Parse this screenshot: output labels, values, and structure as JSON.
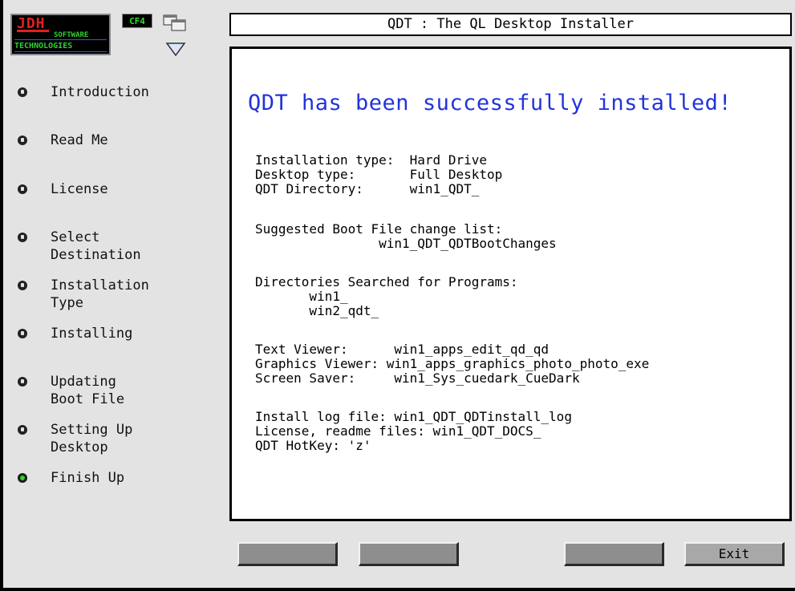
{
  "logo": {
    "line1": "JDH",
    "line2": "SOFTWARE",
    "line3": "TECHNOLOGIES"
  },
  "badge": "CF4",
  "icons": {
    "windows": "windows-icon",
    "down": "down-arrow-icon"
  },
  "title": "QDT  :  The QL Desktop Installer",
  "steps": [
    {
      "label": "Introduction",
      "active": false
    },
    {
      "label": "Read Me",
      "active": false
    },
    {
      "label": "License",
      "active": false
    },
    {
      "label": "Select\nDestination",
      "active": false
    },
    {
      "label": "Installation\nType",
      "active": false
    },
    {
      "label": "Installing",
      "active": false
    },
    {
      "label": "Updating\nBoot File",
      "active": false
    },
    {
      "label": "Setting Up\nDesktop",
      "active": false
    },
    {
      "label": "Finish Up",
      "active": true
    }
  ],
  "main": {
    "headline": "QDT has been successfully installed!",
    "lines": [
      "Installation type:  Hard Drive",
      "Desktop type:       Full Desktop",
      "QDT Directory:      win1_QDT_",
      "Suggested Boot File change list:",
      "                win1_QDT_QDTBootChanges",
      "Directories Searched for Programs:",
      "       win1_",
      "       win2_qdt_",
      "Text Viewer:      win1_apps_edit_qd_qd",
      "Graphics Viewer: win1_apps_graphics_photo_photo_exe",
      "Screen Saver:     win1_Sys_cuedark_CueDark",
      "Install log file: win1_QDT_QDTinstall_log",
      "License, readme files: win1_QDT_DOCS_",
      "QDT HotKey: 'z'"
    ]
  },
  "buttons": {
    "exit": "Exit"
  },
  "colors": {
    "headline": "#2233dd",
    "active_step": "#2ad42a"
  }
}
